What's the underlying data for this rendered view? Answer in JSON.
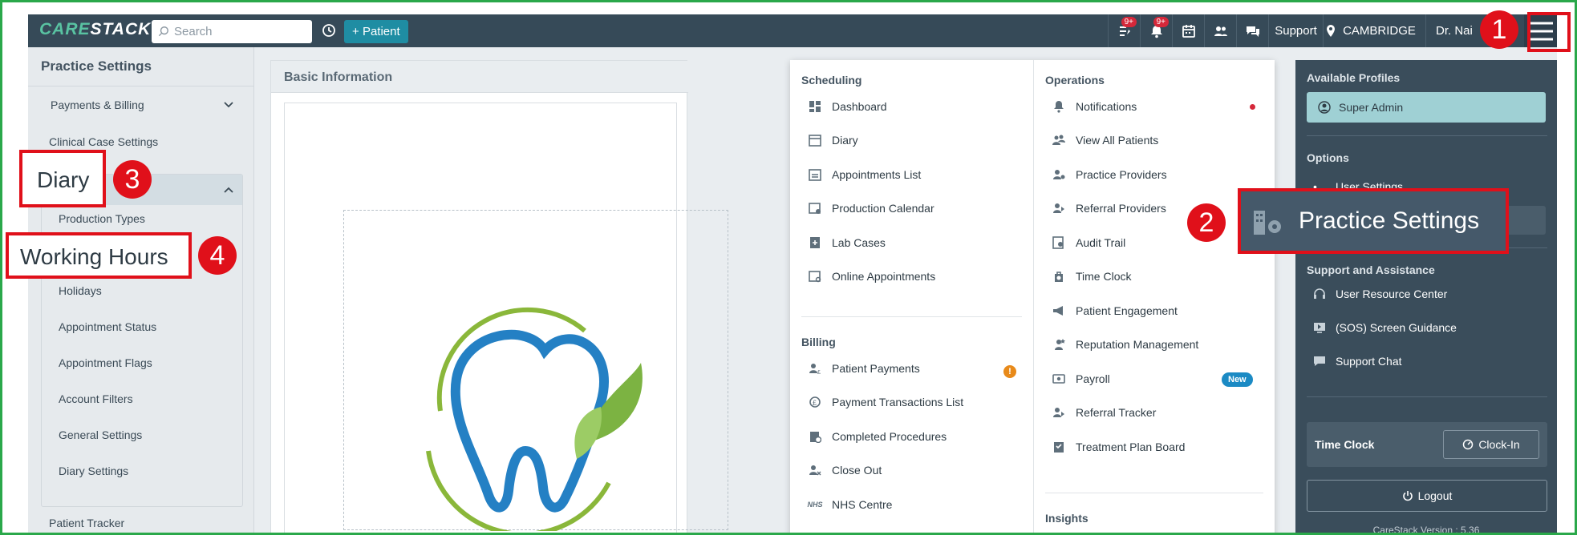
{
  "topbar": {
    "logo_a": "CARE",
    "logo_b": "STACK",
    "search_placeholder": "Search",
    "patient_button": "Patient",
    "badge1": "9+",
    "badge2": "9+",
    "support": "Support",
    "location": "CAMBRIDGE",
    "user": "Dr. Nai"
  },
  "left_panel": {
    "title": "Practice Settings",
    "items": [
      "Payments & Billing",
      "Clinical Case Settings"
    ],
    "diary_sub": [
      "Production Types",
      "Holidays",
      "Appointment Status",
      "Appointment Flags",
      "Account Filters",
      "General Settings",
      "Diary Settings"
    ],
    "after": "Patient Tracker"
  },
  "main": {
    "title": "Basic Information"
  },
  "menu": {
    "scheduling": {
      "heading": "Scheduling",
      "items": [
        "Dashboard",
        "Diary",
        "Appointments List",
        "Production Calendar",
        "Lab Cases",
        "Online Appointments"
      ]
    },
    "billing": {
      "heading": "Billing",
      "items": [
        "Patient Payments",
        "Payment Transactions List",
        "Completed Procedures",
        "Close Out",
        "NHS Centre"
      ],
      "nhs_tag": "NHS"
    },
    "operations": {
      "heading": "Operations",
      "items": [
        "Notifications",
        "View All Patients",
        "Practice Providers",
        "Referral Providers",
        "Audit Trail",
        "Time Clock",
        "Patient Engagement",
        "Reputation Management",
        "Payroll",
        "Referral Tracker",
        "Treatment Plan Board"
      ],
      "new_badge": "New",
      "warn_mark": "!"
    },
    "insights": {
      "heading": "Insights"
    }
  },
  "right_panel": {
    "available_profiles": "Available Profiles",
    "super_admin": "Super Admin",
    "options": "Options",
    "user_settings": "User Settings",
    "support_heading": "Support and Assistance",
    "support_items": [
      "User Resource Center",
      "(SOS) Screen Guidance",
      "Support Chat"
    ],
    "time_clock": "Time Clock",
    "clock_in": "Clock-In",
    "logout": "Logout",
    "version": "CareStack Version : 5.36"
  },
  "annotations": {
    "n1": "1",
    "n2": "2",
    "n3": "3",
    "n4": "4",
    "practice_settings": "Practice Settings",
    "diary": "Diary",
    "working_hours": "Working Hours"
  },
  "colors": {
    "topbar": "#364a58",
    "accent": "#1f8da3",
    "annotation_red": "#e0101a"
  }
}
